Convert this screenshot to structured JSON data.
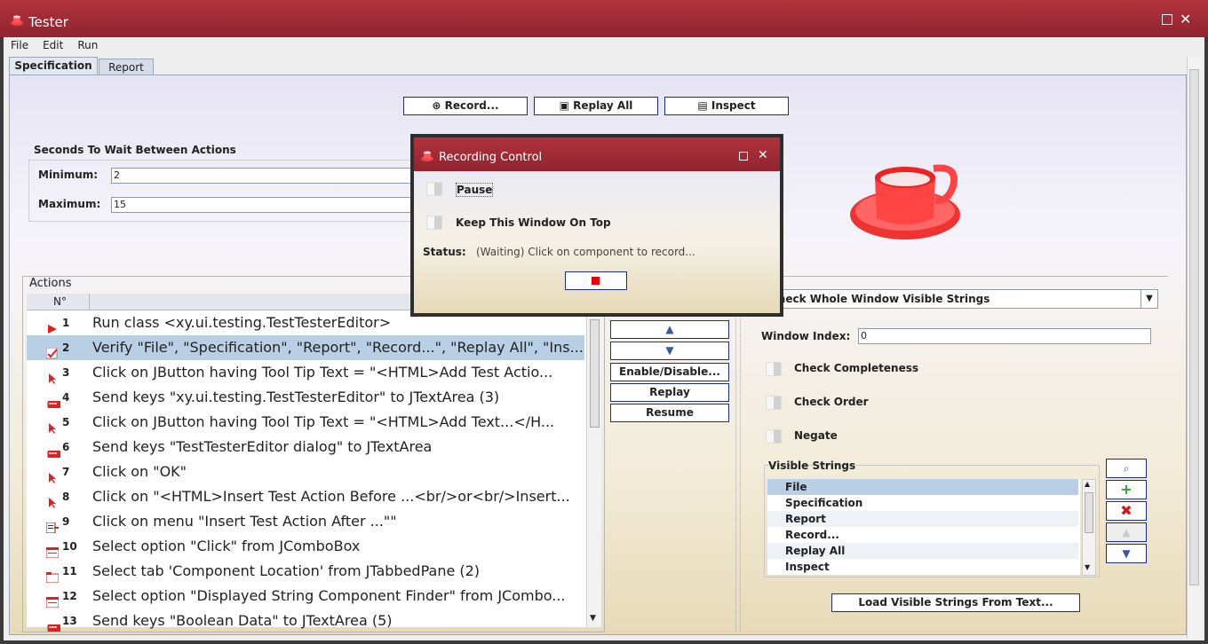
{
  "window": {
    "title": "Tester"
  },
  "menu": [
    "File",
    "Edit",
    "Run"
  ],
  "tabs": [
    {
      "label": "Specification",
      "active": true
    },
    {
      "label": "Report",
      "active": false
    }
  ],
  "toolbar": {
    "record": "Record...",
    "replay_all": "Replay All",
    "inspect": "Inspect"
  },
  "wait": {
    "heading": "Seconds To Wait Between Actions",
    "min_label": "Minimum:",
    "min_value": "2",
    "max_label": "Maximum:",
    "max_value": "15"
  },
  "actions": {
    "heading": "Actions",
    "col_num": "N°",
    "rows": [
      {
        "n": "1",
        "text": "Run class <xy.ui.testing.TestTesterEditor>",
        "icon": "play-icon"
      },
      {
        "n": "2",
        "text": "Verify \"File\", \"Specification\", \"Report\", \"Record...\", \"Replay All\", \"Ins...",
        "icon": "spellcheck-icon",
        "selected": true
      },
      {
        "n": "3",
        "text": "Click on JButton having  Tool Tip Text = \"<HTML>Add Test Actio...",
        "icon": "cursor-icon"
      },
      {
        "n": "4",
        "text": "Send keys \"xy.ui.testing.TestTesterEditor\" to JTextArea (3)",
        "icon": "keyboard-icon"
      },
      {
        "n": "5",
        "text": "Click on JButton having  Tool Tip Text = \"<HTML>Add Text...</H...",
        "icon": "cursor-icon"
      },
      {
        "n": "6",
        "text": "Send keys \"TestTesterEditor dialog\" to JTextArea",
        "icon": "keyboard-icon"
      },
      {
        "n": "7",
        "text": "Click on \"OK\"",
        "icon": "cursor-icon"
      },
      {
        "n": "8",
        "text": "Click on \"<HTML>Insert Test Action Before ...<br/>or<br/>Insert...",
        "icon": "cursor-icon"
      },
      {
        "n": "9",
        "text": "Click on menu \"Insert Test Action After ...\"\"",
        "icon": "menu-icon"
      },
      {
        "n": "10",
        "text": "Select option  \"Click\" from JComboBox",
        "icon": "combo-icon"
      },
      {
        "n": "11",
        "text": "Select tab 'Component Location' from JTabbedPane (2)",
        "icon": "tab-icon"
      },
      {
        "n": "12",
        "text": "Select option  \"Displayed String Component Finder\" from JCombo...",
        "icon": "combo-icon"
      },
      {
        "n": "13",
        "text": "Send keys \"Boolean Data\" to JTextArea (5)",
        "icon": "keyboard-icon"
      }
    ]
  },
  "side_buttons": {
    "enable_disable": "Enable/Disable...",
    "replay": "Replay",
    "resume": "Resume"
  },
  "right": {
    "combo_value": "Check Whole Window Visible Strings",
    "window_index_label": "Window Index:",
    "window_index_value": "0",
    "check_completeness": "Check Completeness",
    "check_order": "Check Order",
    "negate": "Negate",
    "visible_strings_label": "Visible Strings",
    "visible_strings": [
      "File",
      "Specification",
      "Report",
      "Record...",
      "Replay All",
      "Inspect"
    ],
    "load_button": "Load Visible Strings From Text..."
  },
  "dialog": {
    "title": "Recording Control",
    "pause": "Pause",
    "keep_on_top": "Keep This Window On Top",
    "status_label": "Status:",
    "status_value": "(Waiting) Click on component to record..."
  },
  "colors": {
    "titlebar": "#9e2a33",
    "accent": "#1d2e8a",
    "selection": "#b8cfe6"
  }
}
